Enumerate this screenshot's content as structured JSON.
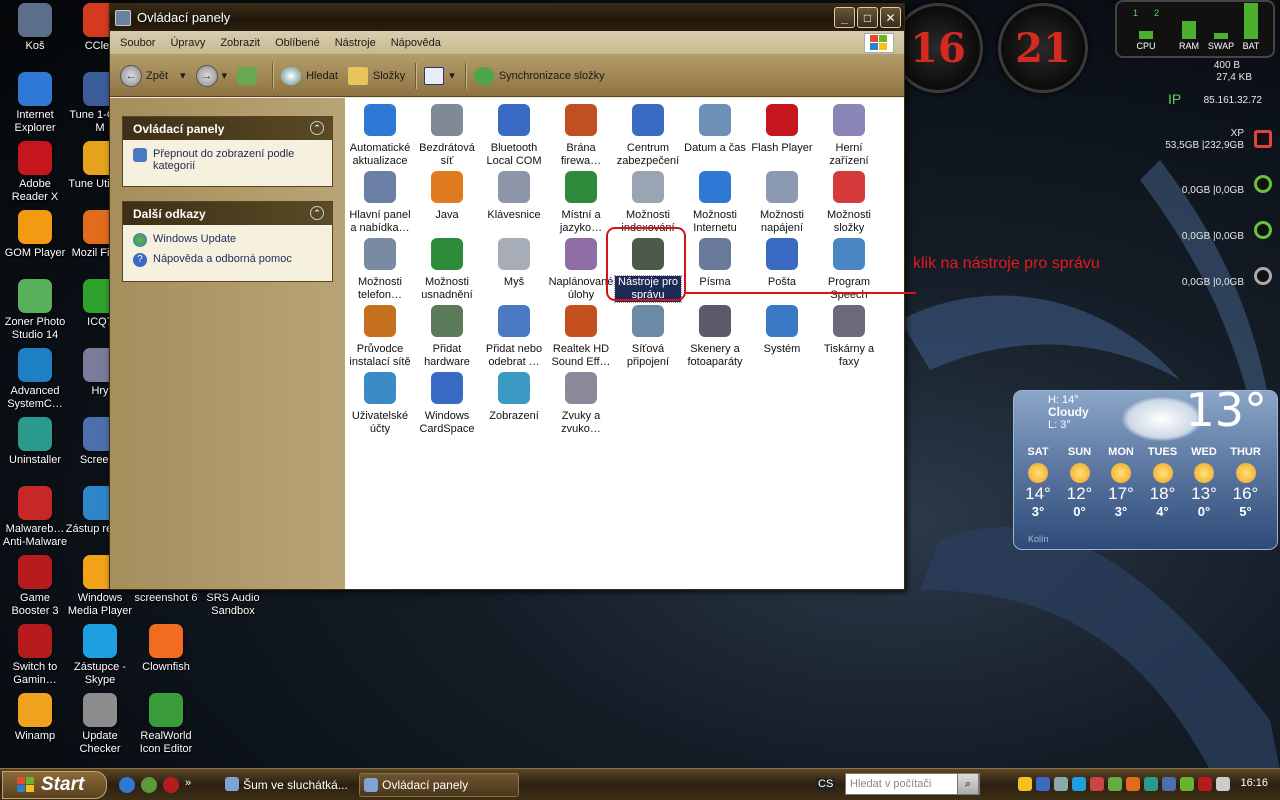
{
  "desktop_icons": [
    {
      "label": "Koš",
      "color": "#5c6f8a"
    },
    {
      "label": "CClea",
      "color": "#d43a1f"
    },
    {
      "label": "Internet Explorer",
      "color": "#2f79d6"
    },
    {
      "label": "Tune 1-Click M",
      "color": "#3c5c9a"
    },
    {
      "label": "Adobe Reader X",
      "color": "#c4161c"
    },
    {
      "label": "Tune Utilities",
      "color": "#e8a31c"
    },
    {
      "label": "GOM Player",
      "color": "#f39a12"
    },
    {
      "label": "Mozil Firefo",
      "color": "#e36b1c"
    },
    {
      "label": "Zoner Photo Studio 14",
      "color": "#58b05a"
    },
    {
      "label": "ICQ7",
      "color": "#2ea12c"
    },
    {
      "label": "Advanced SystemC…",
      "color": "#1d7fc4"
    },
    {
      "label": "Hry",
      "color": "#7b7b9b"
    },
    {
      "label": "Uninstaller",
      "color": "#2a9a8c"
    },
    {
      "label": "Screens",
      "color": "#4d6fae"
    },
    {
      "label": "Malwareb… Anti-Malware",
      "color": "#c62828"
    },
    {
      "label": "Zástup regrep",
      "color": "#2d86c9"
    },
    {
      "label": "Game Booster 3",
      "color": "#b71c1c"
    },
    {
      "label": "Windows Media Player",
      "color": "#f3a21a"
    },
    {
      "label": "screenshot 6",
      "color": "#000000"
    },
    {
      "label": "SRS Audio Sandbox",
      "color": "#000000"
    },
    {
      "label": "Switch to Gamin…",
      "color": "#b71c1c"
    },
    {
      "label": "Zástupce - Skype",
      "color": "#1ea0e0"
    },
    {
      "label": "Clownfish",
      "color": "#f16b20"
    },
    {
      "label": "Winamp",
      "color": "#f0a21e"
    },
    {
      "label": "Update Checker",
      "color": "#8d8d8d"
    },
    {
      "label": "RealWorld Icon Editor",
      "color": "#3b9c3b"
    }
  ],
  "window": {
    "title": "Ovládací panely",
    "menu": [
      "Soubor",
      "Úpravy",
      "Zobrazit",
      "Oblíbené",
      "Nástroje",
      "Nápověda"
    ],
    "toolbar": {
      "back": "Zpět",
      "search": "Hledat",
      "folders": "Složky",
      "sync": "Synchronizace složky"
    }
  },
  "taskpane": {
    "panel1": {
      "title": "Ovládací panely",
      "link": "Přepnout do zobrazení podle kategorií"
    },
    "panel2": {
      "title": "Další odkazy",
      "links": [
        "Windows Update",
        "Nápověda a odborná pomoc"
      ]
    }
  },
  "control_items": [
    {
      "label": "Automatické aktualizace",
      "color": "#2f79d6"
    },
    {
      "label": "Bezdrátová síť",
      "color": "#7f8a96"
    },
    {
      "label": "Bluetooth Local COM",
      "color": "#3a6bc4"
    },
    {
      "label": "Brána firewa…",
      "color": "#c0501f"
    },
    {
      "label": "Centrum zabezpečení",
      "color": "#3a6bc4"
    },
    {
      "label": "Datum a čas",
      "color": "#6e8fb8"
    },
    {
      "label": "Flash Player",
      "color": "#c4161c"
    },
    {
      "label": "Herní zařízení",
      "color": "#8a86b8"
    },
    {
      "label": "Hlavní panel a nabídka…",
      "color": "#6a7ea6"
    },
    {
      "label": "Java",
      "color": "#e07a1e"
    },
    {
      "label": "Klávesnice",
      "color": "#8c96a8"
    },
    {
      "label": "Místní a jazyko…",
      "color": "#2f8a3c"
    },
    {
      "label": "Možnosti indexování",
      "color": "#9aa5b4"
    },
    {
      "label": "Možnosti Internetu",
      "color": "#2f79d6"
    },
    {
      "label": "Možnosti napájení",
      "color": "#8b99b3"
    },
    {
      "label": "Možnosti složky",
      "color": "#d43a3a"
    },
    {
      "label": "Možnosti telefon…",
      "color": "#7a8aa0"
    },
    {
      "label": "Možnosti usnadnění",
      "color": "#2e8b3a"
    },
    {
      "label": "Myš",
      "color": "#a6adb8"
    },
    {
      "label": "Naplánované úlohy",
      "color": "#8f6ea6"
    },
    {
      "label": "Nástroje pro správu",
      "color": "#4d5a4a"
    },
    {
      "label": "Písma",
      "color": "#6a7a9a"
    },
    {
      "label": "Pošta",
      "color": "#3a6bc4"
    },
    {
      "label": "Program Speech",
      "color": "#4a86c4"
    },
    {
      "label": "Průvodce instalací sítě",
      "color": "#c4701e"
    },
    {
      "label": "Přidat hardware",
      "color": "#5a7a5a"
    },
    {
      "label": "Přidat nebo odebrat …",
      "color": "#4a7ac4"
    },
    {
      "label": "Realtek HD Sound Eff…",
      "color": "#c4501e"
    },
    {
      "label": "Síťová připojení",
      "color": "#6a8aa6"
    },
    {
      "label": "Skenery a fotoaparáty",
      "color": "#5a5a6a"
    },
    {
      "label": "Systém",
      "color": "#3a7ac4"
    },
    {
      "label": "Tiskárny a faxy",
      "color": "#6a6a7a"
    },
    {
      "label": "Uživatelské účty",
      "color": "#3a8ac4"
    },
    {
      "label": "Windows CardSpace",
      "color": "#3a6bc4"
    },
    {
      "label": "Zobrazení",
      "color": "#3a9ac4"
    },
    {
      "label": "Zvuky a zvuko…",
      "color": "#8a8a9a"
    }
  ],
  "annotation": "klik na nástroje pro správu",
  "clocks": {
    "hour": "16",
    "minute": "21"
  },
  "sysmeter": {
    "cpu": "CPU",
    "ram": "RAM",
    "swap": "SWAP",
    "bat": "BAT",
    "n1": "1",
    "n2": "2"
  },
  "net": {
    "up": "400 B",
    "down": "27,4 KB",
    "ip_label": "IP",
    "ip": "85.161.32.72"
  },
  "drives": {
    "xp_label": "XP",
    "xp": "53,5GB |232,9GB",
    "d1": "0,0GB |0,0GB",
    "d2": "0,0GB |0,0GB",
    "d3": "0,0GB |0,0GB"
  },
  "weather": {
    "high": "H: 14°",
    "condition": "Cloudy",
    "low": "L: 3°",
    "temp": "13°",
    "city": "Kolín",
    "days": [
      {
        "d": "SAT",
        "hi": "14°",
        "lo": "3°"
      },
      {
        "d": "SUN",
        "hi": "12°",
        "lo": "0°"
      },
      {
        "d": "MON",
        "hi": "17°",
        "lo": "3°"
      },
      {
        "d": "TUES",
        "hi": "18°",
        "lo": "4°"
      },
      {
        "d": "WED",
        "hi": "13°",
        "lo": "0°"
      },
      {
        "d": "THUR",
        "hi": "16°",
        "lo": "5°"
      }
    ]
  },
  "taskbar": {
    "start": "Start",
    "tasks": [
      "Šum ve sluchátká...",
      "Ovládací panely"
    ],
    "lang": "CS",
    "search_placeholder": "Hledat v počítači",
    "time": "16:16"
  }
}
